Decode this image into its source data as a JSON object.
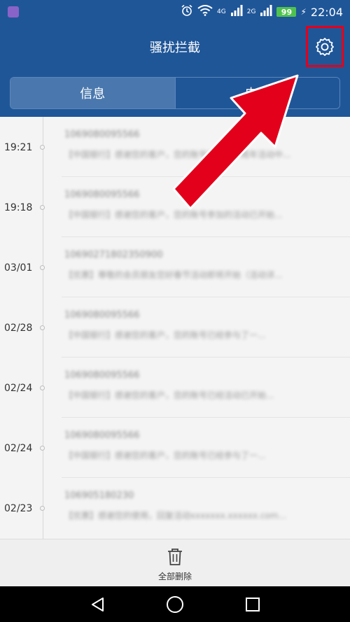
{
  "status_bar": {
    "network_4g": "4G",
    "network_2g": "2G",
    "battery": "99",
    "time": "22:04"
  },
  "header": {
    "title": "骚扰拦截",
    "settings_icon": "gear-icon"
  },
  "tabs": [
    {
      "label": "信息",
      "active": true
    },
    {
      "label": "电话",
      "active": false
    }
  ],
  "messages": [
    {
      "time": "19:21",
      "sender": "1069080095566",
      "preview": "【中国银行】感谢您的客户，您的账号参加的一周年活动中..."
    },
    {
      "time": "19:18",
      "sender": "1069080095566",
      "preview": "【中国银行】感谢您的客户，您的账号参加的活动已开始..."
    },
    {
      "time": "03/01",
      "sender": "10690271802350900",
      "preview": "【优惠】尊敬的会员朋友您好春节活动即将开始（活动详..."
    },
    {
      "time": "02/28",
      "sender": "1069080095566",
      "preview": "【中国银行】感谢您的客户，您的账号已经参与了一..."
    },
    {
      "time": "02/24",
      "sender": "1069080095566",
      "preview": "【中国银行】感谢您的客户，您的账号已经活动已开始..."
    },
    {
      "time": "02/24",
      "sender": "1069080095566",
      "preview": "【中国银行】感谢您的客户，您的账号已经参与了一..."
    },
    {
      "time": "02/23",
      "sender": "106905180230",
      "preview": "【优惠】感谢您的使用，回复活动xxxxxxx.xxxxxx.com..."
    }
  ],
  "action_bar": {
    "delete_all_label": "全部删除"
  },
  "colors": {
    "header_bg": "#1f5698",
    "tab_active_bg": "#4a78ae",
    "annotation_red": "#e3001b"
  }
}
